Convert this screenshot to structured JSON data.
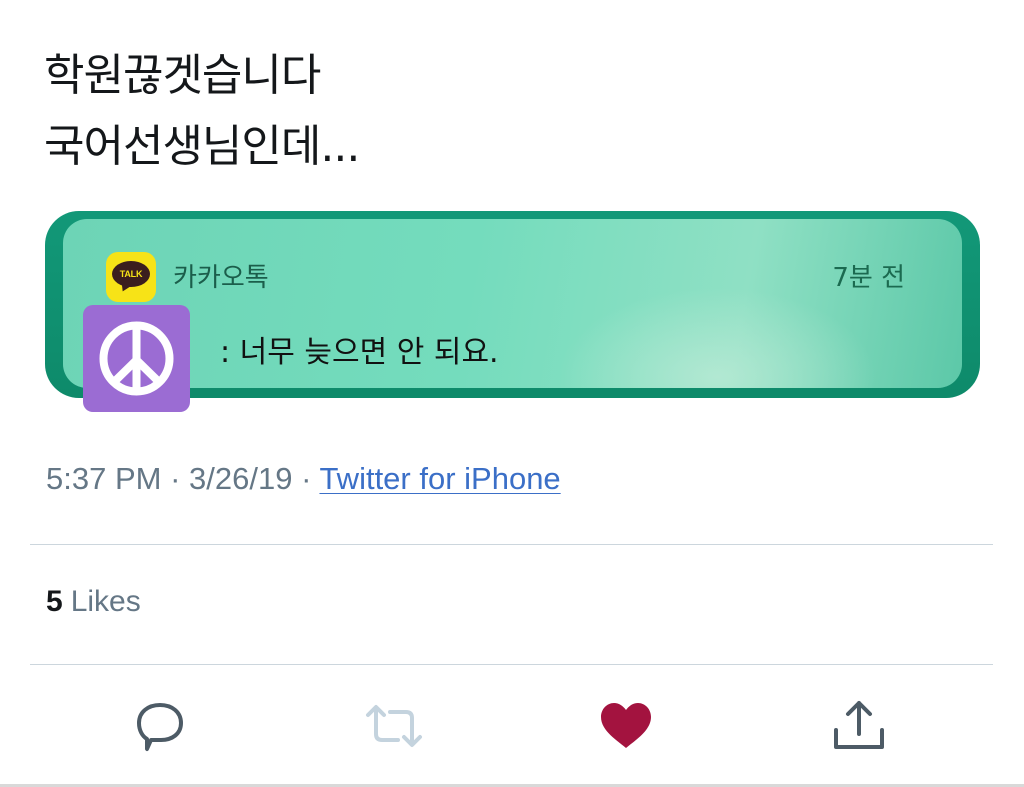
{
  "tweet": {
    "text_lines": [
      "학원끊겟습니다",
      "국어선생님인데..."
    ]
  },
  "notification": {
    "app_name": "카카오톡",
    "app_icon": "kakaotalk-icon",
    "app_icon_text": "TALK",
    "time": "7분 전",
    "message": ": 너무 늦으면 안 되요.",
    "sender_avatar_icon": "peace-sign-icon"
  },
  "meta": {
    "time": "5:37 PM",
    "separator": " · ",
    "date": "3/26/19",
    "source": "Twitter for iPhone"
  },
  "likes": {
    "count": "5",
    "label": "Likes"
  },
  "actions": {
    "reply_icon": "reply-icon",
    "retweet_icon": "retweet-icon",
    "like_icon": "heart-icon",
    "share_icon": "share-icon"
  },
  "colors": {
    "text_primary": "#14171a",
    "text_secondary": "#657786",
    "link": "#3b6fc7",
    "like_active": "#a3133f",
    "kakao_yellow": "#f7e317",
    "notification_green": "#6dd4b6",
    "avatar_purple": "#9b6cd3"
  }
}
